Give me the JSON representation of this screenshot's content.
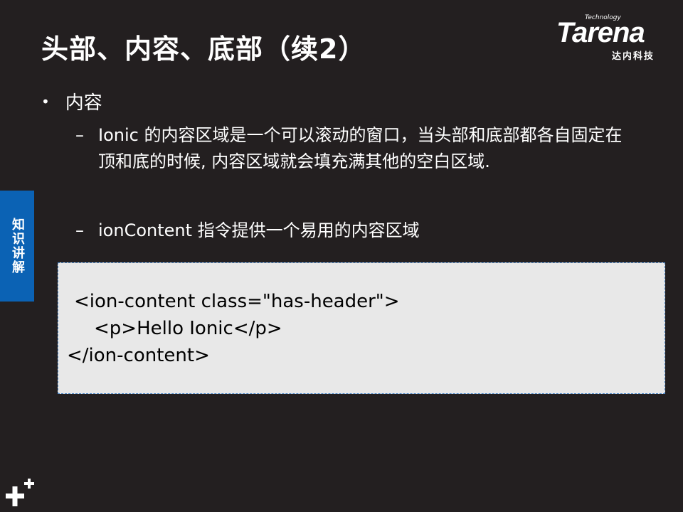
{
  "slide": {
    "title": "头部、内容、底部（续2）",
    "logo": {
      "tagline": "Technology",
      "brand": "Tarena",
      "subtitle": "达内科技"
    },
    "side_tab": {
      "label": "知识讲解"
    },
    "bullet": {
      "marker": "•",
      "text": "内容"
    },
    "sub_items": [
      {
        "marker": "–",
        "text": "Ionic 的内容区域是一个可以滚动的窗口，当头部和底部都各自固定在顶和底的时候, 内容区域就会填充满其他的空白区域."
      },
      {
        "marker": "–",
        "text": "ionContent 指令提供一个易用的内容区域"
      }
    ],
    "code": {
      "line1": "<ion-content class=\"has-header\">",
      "line2": "<p>Hello Ionic</p>",
      "line3": "</ion-content>"
    },
    "corner_icon": "plus-icon"
  }
}
